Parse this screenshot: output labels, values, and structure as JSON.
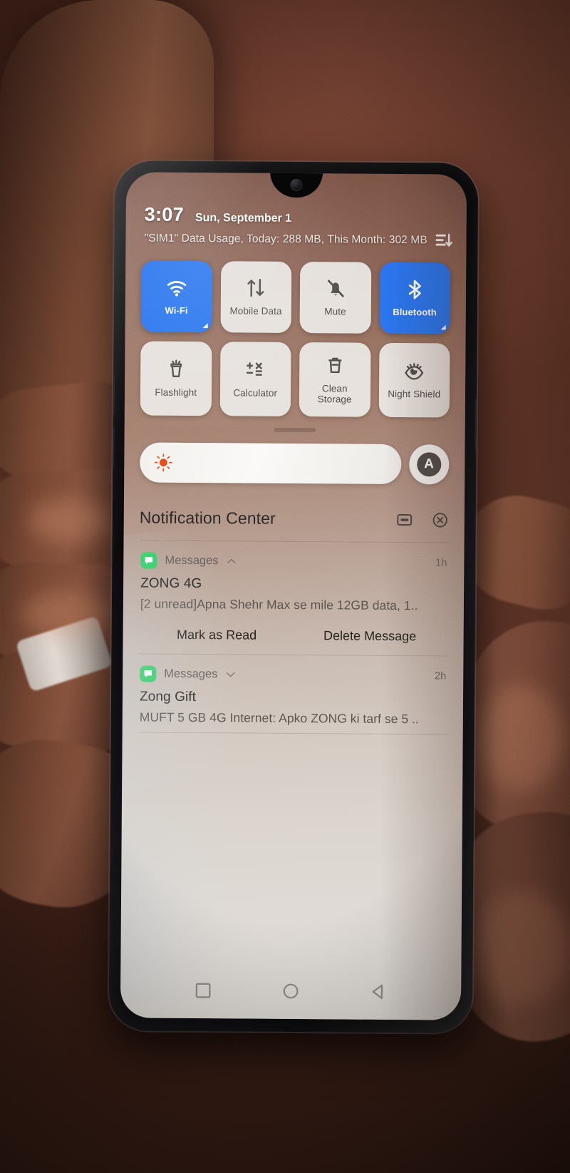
{
  "status": {
    "clock": "3:07",
    "date": "Sun, September 1",
    "data_usage": "\"SIM1\" Data Usage, Today: 288 MB, This Month: 302 MB",
    "icons": {
      "edit_order": "list-sort-icon",
      "settings": "gear-icon"
    }
  },
  "tiles": [
    {
      "label": "Wi-Fi",
      "icon": "wifi-icon",
      "active": true,
      "name": "tile-wifi"
    },
    {
      "label": "Mobile Data",
      "icon": "mobile-data-icon",
      "active": false,
      "name": "tile-mobile-data"
    },
    {
      "label": "Mute",
      "icon": "bell-mute-icon",
      "active": false,
      "name": "tile-mute"
    },
    {
      "label": "Bluetooth",
      "icon": "bluetooth-icon",
      "active": true,
      "name": "tile-bluetooth"
    },
    {
      "label": "Flashlight",
      "icon": "flashlight-icon",
      "active": false,
      "name": "tile-flashlight"
    },
    {
      "label": "Calculator",
      "icon": "calculator-icon",
      "active": false,
      "name": "tile-calculator"
    },
    {
      "label": "Clean\nStorage",
      "icon": "trash-icon",
      "active": false,
      "name": "tile-clean-storage"
    },
    {
      "label": "Night Shield",
      "icon": "night-eye-icon",
      "active": false,
      "name": "tile-night-shield"
    }
  ],
  "brightness": {
    "sun_icon": "sun-icon",
    "auto_label": "A",
    "level_percent": 100
  },
  "notification_center": {
    "title": "Notification Center",
    "actions": {
      "manage": "notification-settings-icon",
      "clear_all": "clear-all-icon"
    },
    "items": [
      {
        "app": "Messages",
        "app_icon": "messages-icon",
        "expanded": true,
        "chevron": "chevron-up-icon",
        "time": "1h",
        "title": "ZONG 4G",
        "body": "[2 unread]Apna Shehr Max se mile 12GB data, 1..",
        "actions": [
          "Mark as Read",
          "Delete Message"
        ]
      },
      {
        "app": "Messages",
        "app_icon": "messages-icon",
        "expanded": false,
        "chevron": "chevron-down-icon",
        "time": "2h",
        "title": "Zong Gift",
        "body": "MUFT 5 GB 4G Internet: Apko ZONG ki tarf se 5 ..",
        "actions": []
      }
    ]
  },
  "navbar": {
    "recents": "square-recents-icon",
    "home": "circle-home-icon",
    "back": "triangle-back-icon"
  },
  "colors": {
    "tile_active": "#2b79f0",
    "tile_inactive": "#eeece8",
    "messages_green": "#35d16a",
    "sun_orange": "#e8501f"
  }
}
